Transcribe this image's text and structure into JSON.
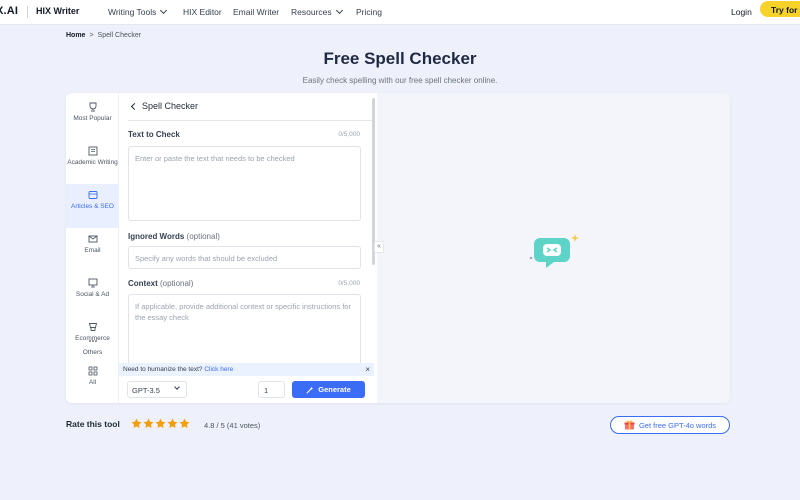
{
  "header": {
    "brand": "X.AI",
    "product": "HIX Writer",
    "nav": [
      {
        "label": "Writing Tools",
        "has_dropdown": true
      },
      {
        "label": "HIX Editor",
        "has_dropdown": false
      },
      {
        "label": "Email Writer",
        "has_dropdown": false
      },
      {
        "label": "Resources",
        "has_dropdown": true
      },
      {
        "label": "Pricing",
        "has_dropdown": false
      }
    ],
    "login": "Login",
    "try_button": "Try for f"
  },
  "breadcrumb": {
    "home": "Home",
    "separator": ">",
    "current": "Spell Checker"
  },
  "page": {
    "title": "Free Spell Checker",
    "subtitle": "Easily check spelling with our free spell checker online."
  },
  "categories": [
    {
      "label": "Most Popular",
      "icon": "trophy-icon",
      "active": false
    },
    {
      "label": "Academic Writing",
      "icon": "book-icon",
      "active": false
    },
    {
      "label": "Articles & SEO",
      "icon": "article-icon",
      "active": true
    },
    {
      "label": "Email",
      "icon": "mail-icon",
      "active": false
    },
    {
      "label": "Social & Ad",
      "icon": "megaphone-icon",
      "active": false
    },
    {
      "label": "Ecommerce",
      "icon": "cart-icon",
      "active": false
    },
    {
      "label": "Others",
      "icon": "more-icon",
      "active": false
    },
    {
      "label": "All",
      "icon": "grid-icon",
      "active": false
    }
  ],
  "form": {
    "back_label": "Spell Checker",
    "text_label": "Text to Check",
    "text_count": "0/5,000",
    "text_placeholder": "Enter or paste the text that needs to be checked",
    "ignored_label": "Ignored Words",
    "ignored_optional": "(optional)",
    "ignored_placeholder": "Specify any words that should be excluded",
    "context_label": "Context",
    "context_optional": "(optional)",
    "context_count": "0/5,000",
    "context_placeholder": "If applicable, provide additional context or specific instructions for the essay check"
  },
  "humanize": {
    "text": "Need to humanize the text?",
    "link": "Click here",
    "close": "×"
  },
  "controls": {
    "model": "GPT-3.5",
    "quantity": "1",
    "generate": "Generate"
  },
  "collapse_label": "«",
  "rating": {
    "label": "Rate this tool",
    "stars": 5,
    "score": "4.8 / 5 (41 votes)"
  },
  "promo": {
    "label": "Get free GPT-4o words"
  },
  "colors": {
    "accent": "#3b6cf5",
    "star": "#f59e0b",
    "try_button": "#f7d22a",
    "bot": "#5ed3c7"
  }
}
